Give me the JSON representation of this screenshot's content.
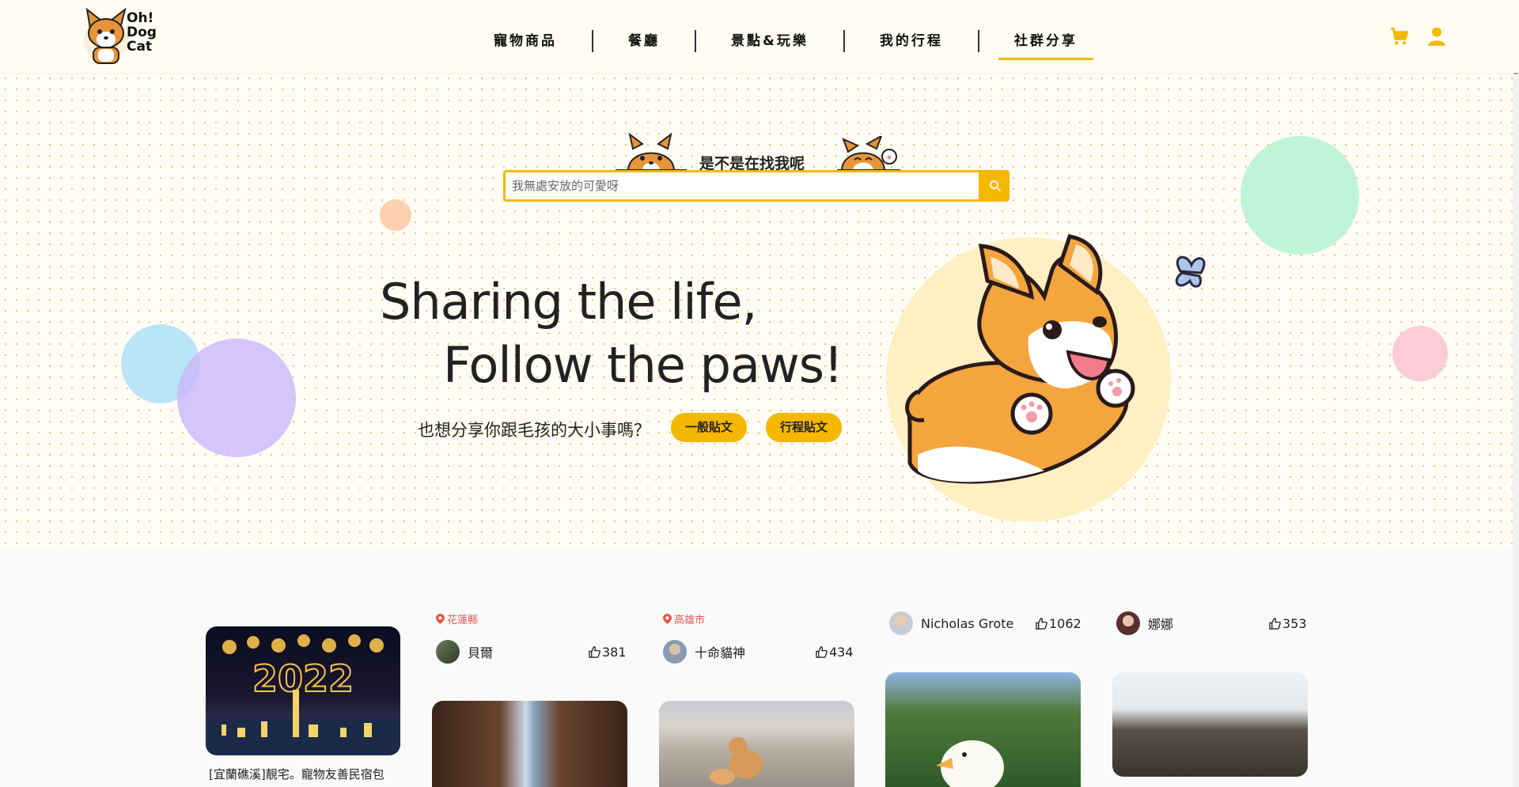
{
  "header": {
    "logo_line1": "Oh!",
    "logo_line2": "Dog",
    "logo_line3": "Cat",
    "nav": [
      {
        "label": "寵物商品"
      },
      {
        "label": "餐廳"
      },
      {
        "label": "景點&玩樂"
      },
      {
        "label": "我的行程"
      },
      {
        "label": "社群分享",
        "active": true
      }
    ],
    "icons": [
      "cart-icon",
      "user-icon"
    ],
    "accent": "#f5b800"
  },
  "search": {
    "label": "是不是在找我呢",
    "placeholder": "我無處安放的可愛呀"
  },
  "hero": {
    "title_line1": "Sharing the life,",
    "title_line2": "Follow the paws!",
    "subtitle": "也想分享你跟毛孩的大小事嗎？",
    "button_general": "一般貼文",
    "button_itinerary": "行程貼文"
  },
  "posts": [
    {
      "caption": "[宜蘭礁溪]靚宅。寵物友善民宿包"
    },
    {
      "location": "花蓮縣",
      "author": "貝爾",
      "likes": "381"
    },
    {
      "location": "高雄市",
      "author": "十命貓神",
      "likes": "434"
    },
    {
      "author": "Nicholas Grote",
      "likes": "1062"
    },
    {
      "author": "娜娜",
      "likes": "353"
    }
  ],
  "colors": {
    "accent": "#f5b800",
    "location": "#e05a4e",
    "hero_bg": "#fffdf6"
  }
}
